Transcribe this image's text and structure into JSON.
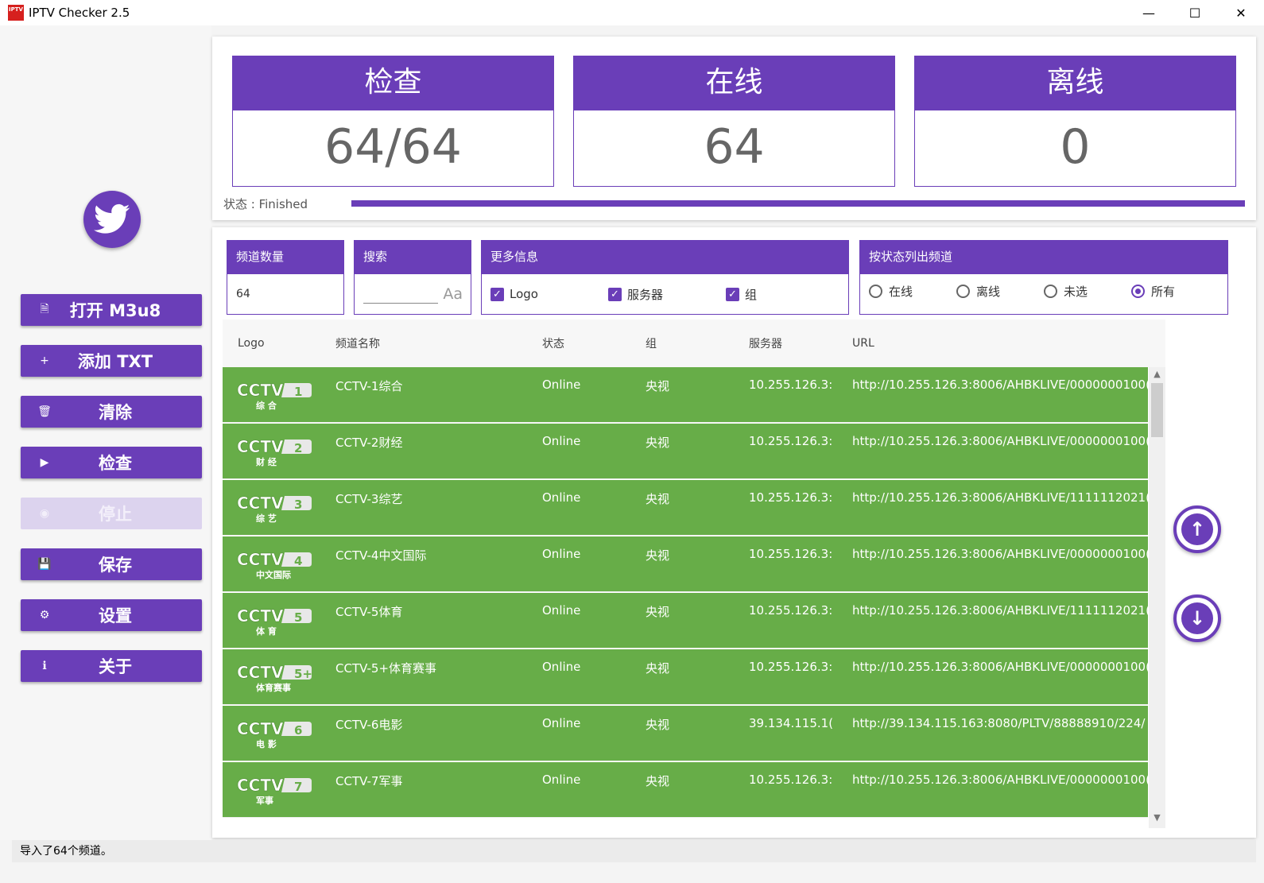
{
  "window": {
    "title": "IPTV Checker 2.5",
    "icon_text": "IPTV",
    "minimize": "—",
    "maximize": "☐",
    "close": "✕"
  },
  "sidebar": {
    "buttons": [
      {
        "label": "打开 M3u8",
        "icon": "file-icon",
        "glyph": "🗎"
      },
      {
        "label": "添加 TXT",
        "icon": "plus-icon",
        "glyph": "+"
      },
      {
        "label": "清除",
        "icon": "trash-icon",
        "glyph": "🗑"
      },
      {
        "label": "检查",
        "icon": "play-icon",
        "glyph": "▶"
      },
      {
        "label": "停止",
        "icon": "stop-icon",
        "glyph": "◉",
        "disabled": true
      },
      {
        "label": "保存",
        "icon": "save-icon",
        "glyph": "💾"
      },
      {
        "label": "设置",
        "icon": "gear-icon",
        "glyph": "⚙"
      },
      {
        "label": "关于",
        "icon": "info-icon",
        "glyph": "ℹ"
      }
    ]
  },
  "stats": {
    "check": {
      "label": "检查",
      "value": "64/64"
    },
    "online": {
      "label": "在线",
      "value": "64"
    },
    "offline": {
      "label": "离线",
      "value": "0"
    },
    "status_text": "状态 : Finished",
    "progress": 1.0
  },
  "filters": {
    "count": {
      "header": "频道数量",
      "value": "64"
    },
    "search": {
      "header": "搜索",
      "placeholder": "Aa"
    },
    "more": {
      "header": "更多信息",
      "options": [
        "Logo",
        "服务器",
        "组"
      ]
    },
    "status": {
      "header": "按状态列出频道",
      "options": [
        "在线",
        "离线",
        "未选",
        "所有"
      ],
      "selected": "所有"
    }
  },
  "table": {
    "columns": [
      "Logo",
      "频道名称",
      "状态",
      "组",
      "服务器",
      "URL"
    ],
    "rows": [
      {
        "logo_num": "1",
        "logo_sub": "综 合",
        "name": "CCTV-1综合",
        "status": "Online",
        "group": "央视",
        "server": "10.255.126.3:",
        "url": "http://10.255.126.3:8006/AHBKLIVE/0000000100("
      },
      {
        "logo_num": "2",
        "logo_sub": "财 经",
        "name": "CCTV-2财经",
        "status": "Online",
        "group": "央视",
        "server": "10.255.126.3:",
        "url": "http://10.255.126.3:8006/AHBKLIVE/0000000100("
      },
      {
        "logo_num": "3",
        "logo_sub": "综 艺",
        "name": "CCTV-3综艺",
        "status": "Online",
        "group": "央视",
        "server": "10.255.126.3:",
        "url": "http://10.255.126.3:8006/AHBKLIVE/1111112021("
      },
      {
        "logo_num": "4",
        "logo_sub": "中文国际",
        "name": "CCTV-4中文国际",
        "status": "Online",
        "group": "央视",
        "server": "10.255.126.3:",
        "url": "http://10.255.126.3:8006/AHBKLIVE/0000000100("
      },
      {
        "logo_num": "5",
        "logo_sub": "体 育",
        "name": "CCTV-5体育",
        "status": "Online",
        "group": "央视",
        "server": "10.255.126.3:",
        "url": "http://10.255.126.3:8006/AHBKLIVE/1111112021("
      },
      {
        "logo_num": "5+",
        "logo_sub": "体育赛事",
        "name": "CCTV-5+体育赛事",
        "status": "Online",
        "group": "央视",
        "server": "10.255.126.3:",
        "url": "http://10.255.126.3:8006/AHBKLIVE/0000000100("
      },
      {
        "logo_num": "6",
        "logo_sub": "电 影",
        "name": "CCTV-6电影",
        "status": "Online",
        "group": "央视",
        "server": "39.134.115.1(",
        "url": "http://39.134.115.163:8080/PLTV/88888910/224/"
      },
      {
        "logo_num": "7",
        "logo_sub": "军事",
        "name": "CCTV-7军事",
        "status": "Online",
        "group": "央视",
        "server": "10.255.126.3:",
        "url": "http://10.255.126.3:8006/AHBKLIVE/0000000100("
      }
    ]
  },
  "status_bar": "导入了64个频道。",
  "colors": {
    "accent": "#6a3eb8",
    "row_online": "#67ad48",
    "disabled": "#dcd3ee"
  }
}
